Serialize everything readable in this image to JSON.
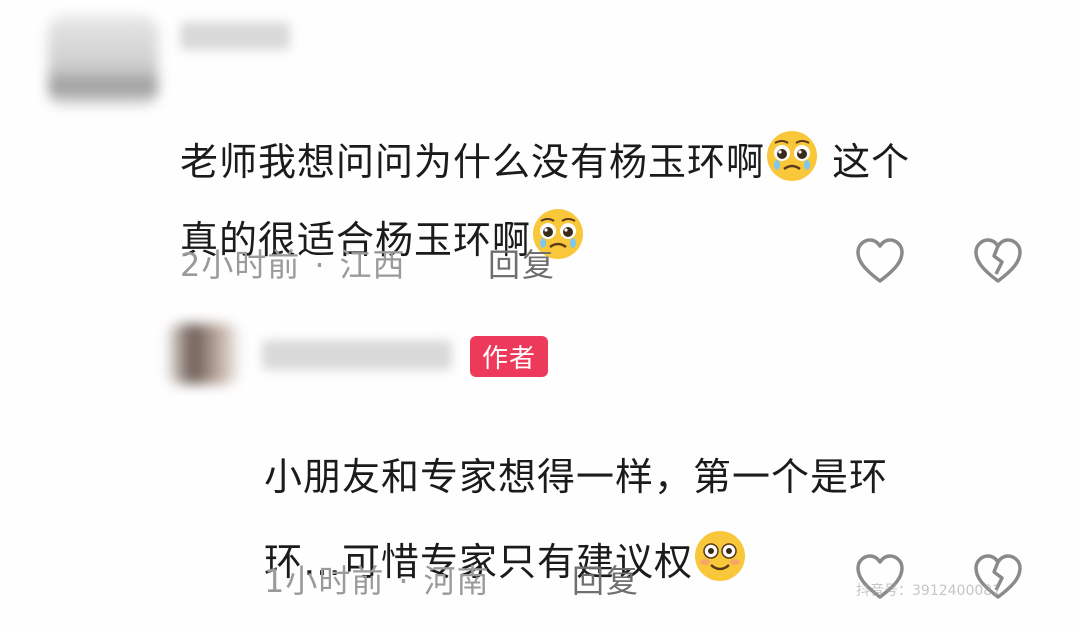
{
  "comments": [
    {
      "text_line1": "老师我想问问为什么没有杨玉环啊",
      "text_line1_tail": " 这个",
      "text_line2": "真的很适合杨玉环啊",
      "emoji1": "pleading-face",
      "emoji2": "pleading-face",
      "time": "2小时前",
      "location": "江西",
      "reply_label": "回复"
    },
    {
      "badge": "作者",
      "text_line1": "小朋友和专家想得一样，第一个是环",
      "text_line2": "环…可惜专家只有建议权",
      "emoji": "smiling-face",
      "time": "1小时前",
      "location": "河南",
      "reply_label": "回复"
    }
  ],
  "separator": "·",
  "watermark": "抖音号：3912400081"
}
